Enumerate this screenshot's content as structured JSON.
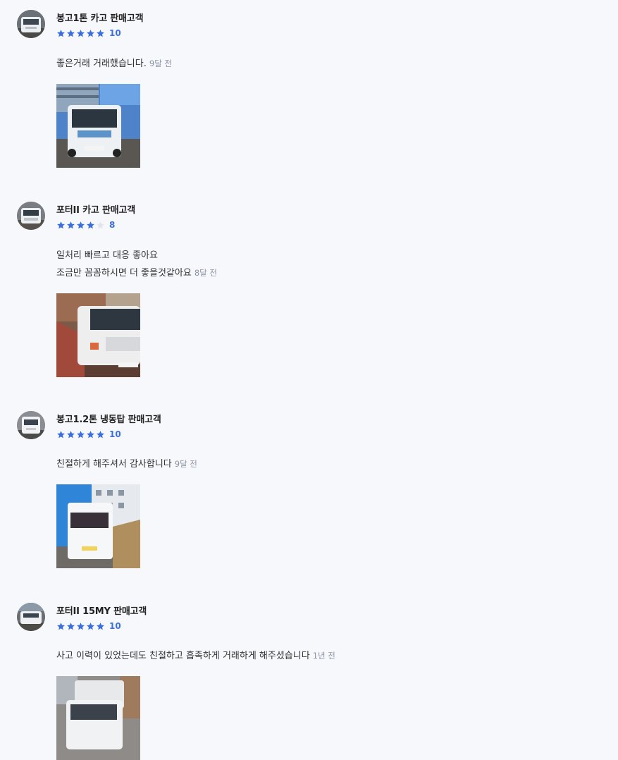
{
  "reviews": [
    {
      "name": "봉고1톤 카고 판매고객",
      "stars": 5,
      "score": "10",
      "lines": [
        "좋은거래 거래했습니다."
      ],
      "time": "9달 전",
      "photo_alt": "truck-photo"
    },
    {
      "name": "포터II 카고 판매고객",
      "stars": 4,
      "score": "8",
      "lines": [
        "일처리 빠르고 대응 좋아요",
        "조금만 꼼꼼하시면 더 좋을것같아요"
      ],
      "time": "8달 전",
      "photo_alt": "truck-photo"
    },
    {
      "name": "봉고1.2톤 냉동탑 판매고객",
      "stars": 5,
      "score": "10",
      "lines": [
        "친절하게 해주셔서 감사합니다"
      ],
      "time": "9달 전",
      "photo_alt": "truck-photo"
    },
    {
      "name": "포터II 15MY 판매고객",
      "stars": 5,
      "score": "10",
      "lines": [
        "사고 이력이 있었는데도 친절하고 흡족하게 거래하게 해주셨습니다"
      ],
      "time": "1년 전",
      "photo_alt": "truck-photo"
    }
  ],
  "colors": {
    "star_filled": "#3b6fe0",
    "star_empty": "#e3e5ea",
    "time_text": "#8a93a6",
    "background": "#f7f8fb"
  }
}
